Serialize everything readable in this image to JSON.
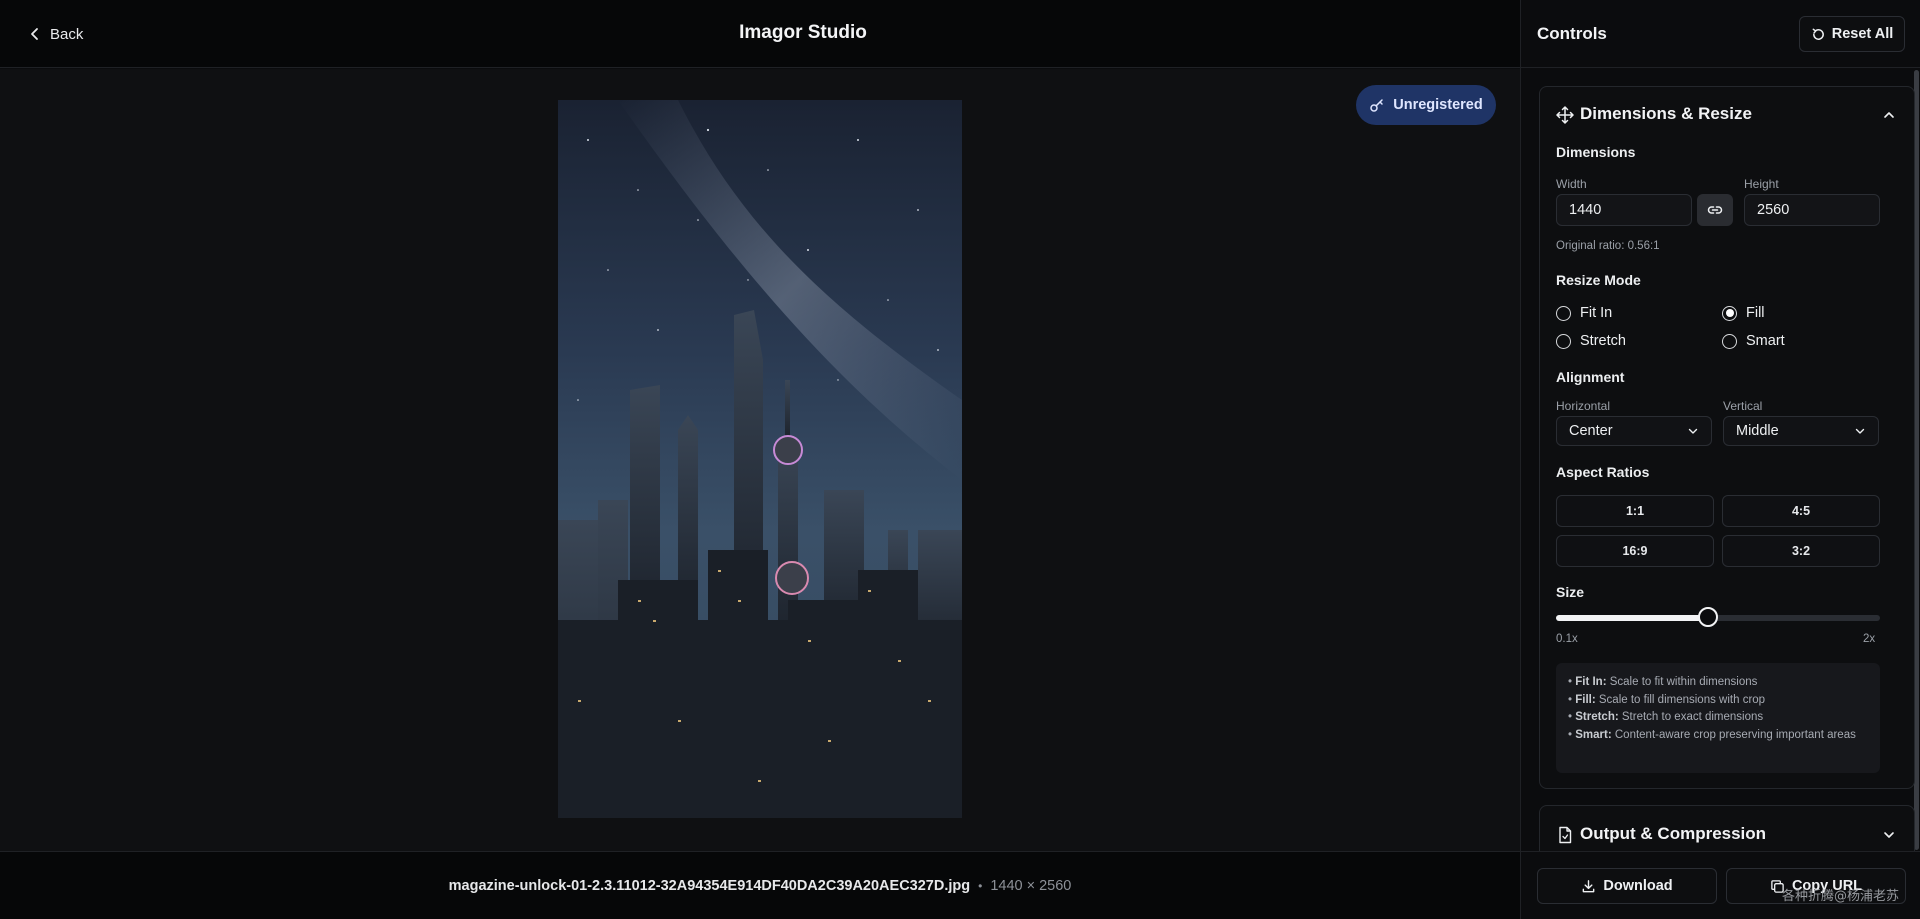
{
  "header": {
    "back_label": "Back",
    "title": "Imagor Studio"
  },
  "badge": {
    "label": "Unregistered"
  },
  "file": {
    "name": "magazine-unlock-01-2.3.11012-32A94354E914DF40DA2C39A20AEC327D.jpg",
    "separator": "•",
    "dims": "1440 × 2560"
  },
  "panel": {
    "title": "Controls",
    "reset_label": "Reset All",
    "dimensions_section": {
      "title": "Dimensions & Resize",
      "dimensions_label": "Dimensions",
      "width_label": "Width",
      "width_value": "1440",
      "height_label": "Height",
      "height_value": "2560",
      "original_ratio": "Original ratio: 0.56:1",
      "resize_mode_label": "Resize Mode",
      "modes": [
        {
          "label": "Fit In",
          "selected": false
        },
        {
          "label": "Fill",
          "selected": true
        },
        {
          "label": "Stretch",
          "selected": false
        },
        {
          "label": "Smart",
          "selected": false
        }
      ],
      "alignment_label": "Alignment",
      "horizontal_label": "Horizontal",
      "horizontal_value": "Center",
      "vertical_label": "Vertical",
      "vertical_value": "Middle",
      "aspect_label": "Aspect Ratios",
      "ratios": [
        "1:1",
        "4:5",
        "16:9",
        "3:2"
      ],
      "size_label": "Size",
      "size_min": "0.1x",
      "size_max": "2x",
      "size_fraction": 0.47,
      "help": [
        {
          "term": "Fit In:",
          "desc": " Scale to fit within dimensions"
        },
        {
          "term": "Fill:",
          "desc": " Scale to fill dimensions with crop"
        },
        {
          "term": "Stretch:",
          "desc": " Stretch to exact dimensions"
        },
        {
          "term": "Smart:",
          "desc": " Content-aware crop preserving important areas"
        }
      ]
    },
    "output_section": {
      "title": "Output & Compression"
    },
    "download_label": "Download",
    "copy_label": "Copy URL",
    "watermark": "各种折腾@杨浦老苏"
  },
  "colors": {
    "badge_bg": "#1f3466",
    "background": "#0b0c0e",
    "panel_border": "#24272c"
  },
  "icons": [
    "chevron-left-icon",
    "key-icon",
    "reset-icon",
    "move-icon",
    "chevron-up-icon",
    "link-icon",
    "chevron-down-icon",
    "file-icon",
    "download-icon",
    "copy-icon"
  ]
}
